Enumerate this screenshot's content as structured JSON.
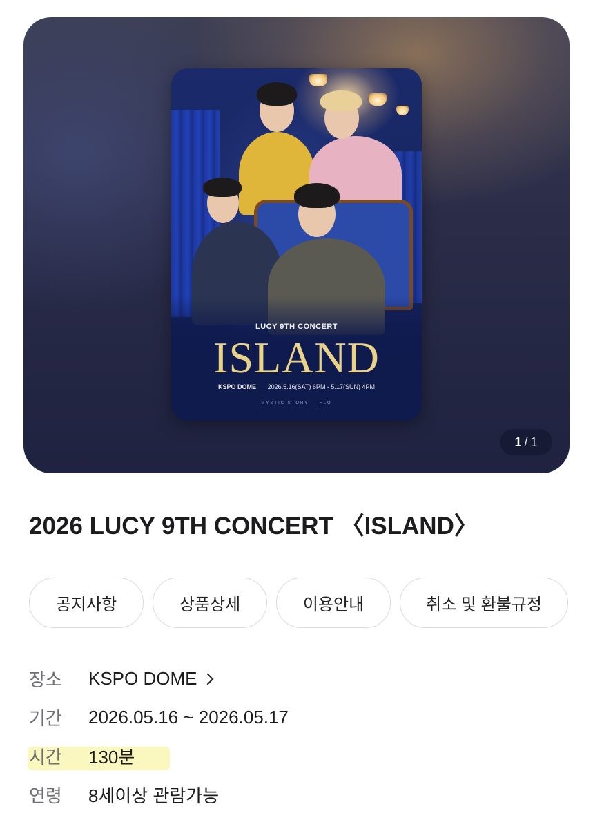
{
  "carousel": {
    "current": "1",
    "separator": "/",
    "total": "1",
    "poster": {
      "subtitle": "LUCY 9TH CONCERT",
      "title": "ISLAND",
      "venue": "KSPO DOME",
      "dates": "2026.5.16(SAT) 6PM - 5.17(SUN) 4PM",
      "logo_left": "MYSTIC STORY",
      "logo_right": "FLO"
    }
  },
  "event": {
    "title": "2026 LUCY 9TH CONCERT 〈ISLAND〉"
  },
  "tabs": [
    {
      "label": "공지사항"
    },
    {
      "label": "상품상세"
    },
    {
      "label": "이용안내"
    },
    {
      "label": "취소 및 환불규정"
    }
  ],
  "details": {
    "venue": {
      "label": "장소",
      "value": "KSPO DOME"
    },
    "period": {
      "label": "기간",
      "value": "2026.05.16 ~ 2026.05.17"
    },
    "runtime": {
      "label": "시간",
      "value": "130분"
    },
    "age": {
      "label": "연령",
      "value": "8세이상 관람가능"
    }
  }
}
